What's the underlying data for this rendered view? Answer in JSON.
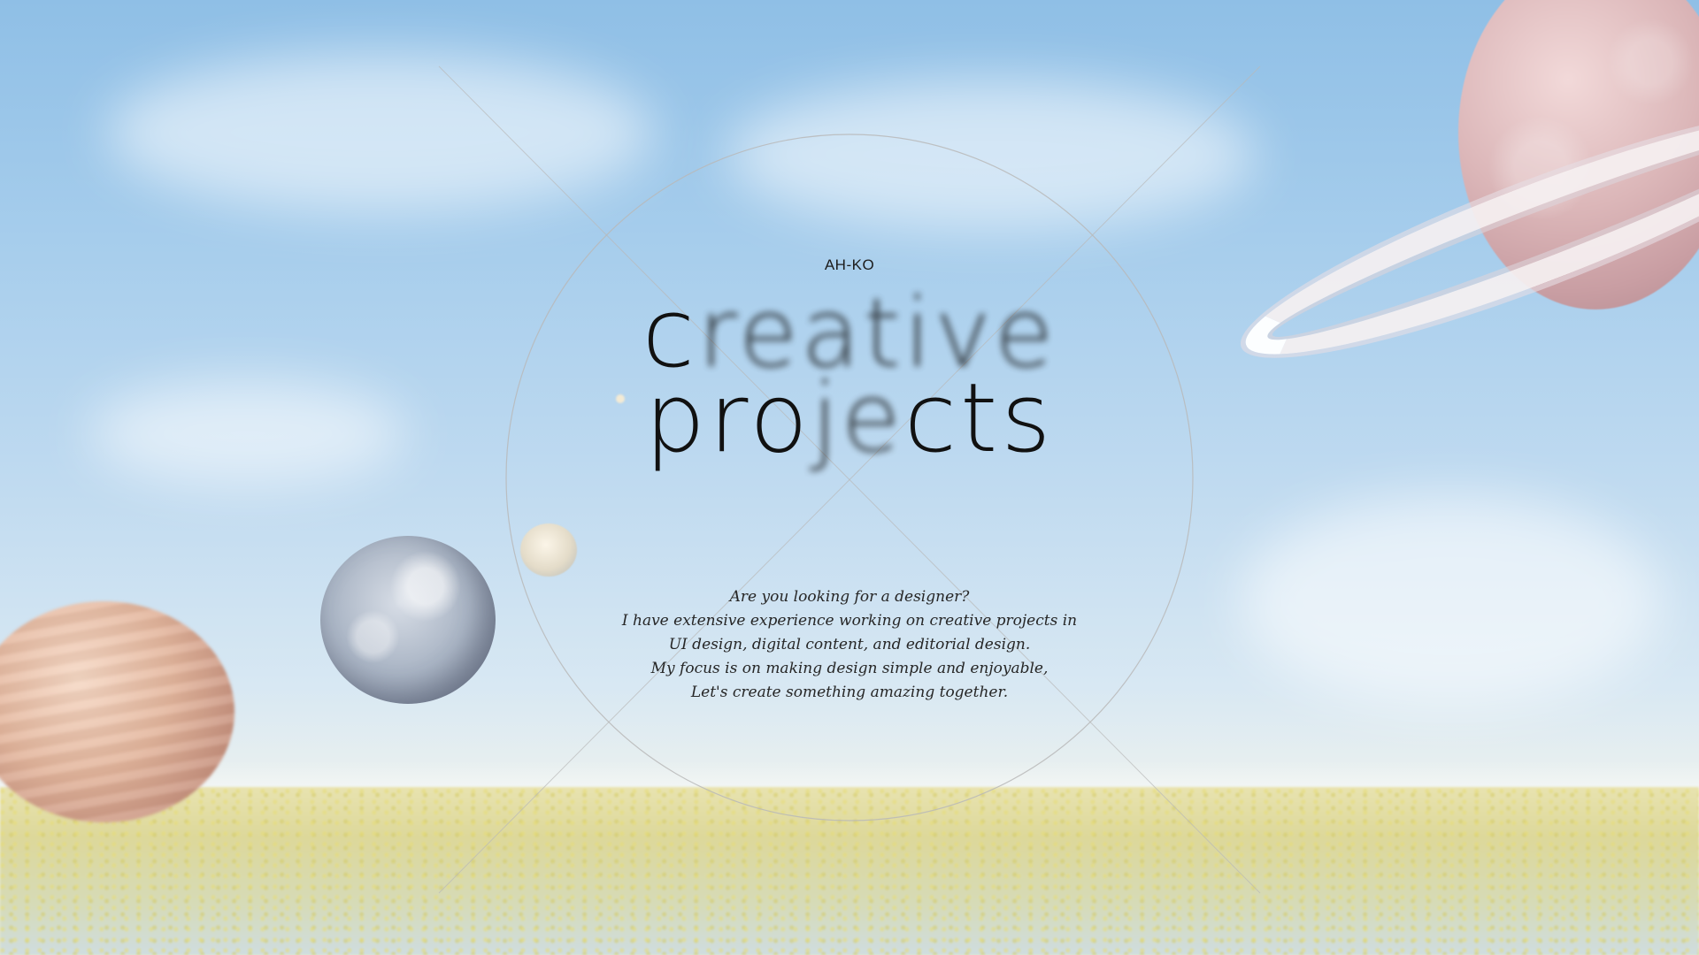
{
  "hero": {
    "eyebrow": "AH-KO",
    "headline_line1_a": "c",
    "headline_line1_b": "reative",
    "headline_line2_a": "pro",
    "headline_line2_b": "je",
    "headline_line2_c": "cts",
    "intro": [
      "Are you looking for a designer?",
      "I have extensive experience working on creative projects in",
      "UI design, digital content, and editorial design.",
      "My focus is on making design simple and enjoyable,",
      "Let's create something amazing together."
    ]
  },
  "colors": {
    "text": "#111111",
    "sky_top": "#8fbfe6",
    "line": "#b9b9b9"
  }
}
